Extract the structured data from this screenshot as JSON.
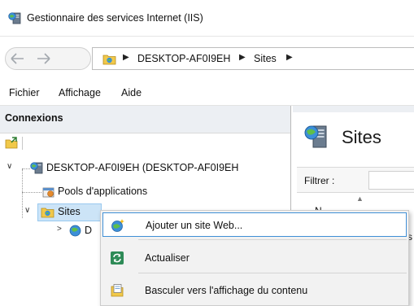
{
  "window": {
    "title": "Gestionnaire des services Internet (IIS)",
    "icon": "iis-manager-icon"
  },
  "address_bar": {
    "back_icon": "arrow-left-icon",
    "forward_icon": "arrow-right-icon",
    "crumbs": [
      "DESKTOP-AF0I9EH",
      "Sites"
    ],
    "separator": "▶"
  },
  "menu": {
    "items": [
      "Fichier",
      "Affichage",
      "Aide"
    ]
  },
  "connections": {
    "title": "Connexions",
    "tree": {
      "server": "DESKTOP-AF0I9EH (DESKTOP-AF0I9EH",
      "app_pools": "Pools d'applications",
      "sites": "Sites",
      "default_site_partial": "D"
    }
  },
  "content": {
    "title": "Sites",
    "filter_label": "Filtrer :",
    "column_partial": "N",
    "row_partial": "s"
  },
  "context_menu": {
    "items": [
      {
        "label": "Ajouter un site Web...",
        "icon": "add-website-icon",
        "highlighted": true
      },
      {
        "label": "Actualiser",
        "icon": "refresh-icon",
        "highlighted": false
      },
      {
        "label": "Basculer vers l'affichage du contenu",
        "icon": "content-view-icon",
        "highlighted": false
      }
    ]
  },
  "colors": {
    "selection_bg": "#cce4f7",
    "selection_border": "#99c9ef",
    "menu_hover_border": "#3f8fd6",
    "pane_header_bg": "#eceff3",
    "context_menu_bg": "#f2f2f2"
  }
}
